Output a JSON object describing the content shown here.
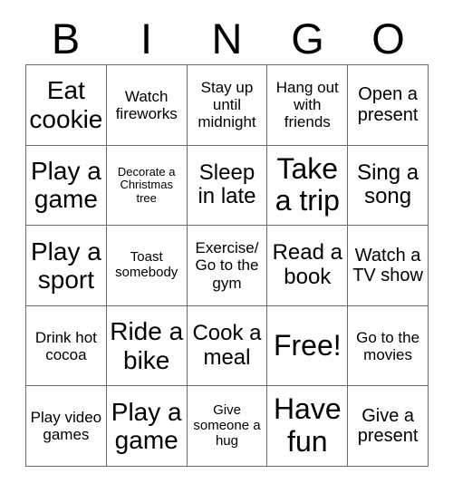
{
  "card": {
    "title": "BINGO",
    "columns": [
      "B",
      "I",
      "N",
      "G",
      "O"
    ],
    "grid_color": "#6b6b6b",
    "background_color": "#ffffff",
    "text_color": "#000000",
    "rows": 5,
    "cols": 5,
    "free_space": "Free!"
  },
  "cells": [
    {
      "text": "Eat cookie",
      "size": "lg"
    },
    {
      "text": "Watch fireworks",
      "size": "xs"
    },
    {
      "text": "Stay up until midnight",
      "size": "xs"
    },
    {
      "text": "Hang out with friends",
      "size": "xs"
    },
    {
      "text": "Open a present",
      "size": "sm"
    },
    {
      "text": "Play a game",
      "size": "lg"
    },
    {
      "text": "Decorate a Christmas tree",
      "size": "tiny"
    },
    {
      "text": "Sleep in late",
      "size": "md"
    },
    {
      "text": "Take a trip",
      "size": "xl"
    },
    {
      "text": "Sing a song",
      "size": "md"
    },
    {
      "text": "Play a sport",
      "size": "lg"
    },
    {
      "text": "Toast somebody",
      "size": "xxs"
    },
    {
      "text": "Exercise/ Go to the gym",
      "size": "xs"
    },
    {
      "text": "Read a book",
      "size": "md"
    },
    {
      "text": "Watch a TV show",
      "size": "sm"
    },
    {
      "text": "Drink hot cocoa",
      "size": "xs"
    },
    {
      "text": "Ride a bike",
      "size": "lg"
    },
    {
      "text": "Cook a meal",
      "size": "md"
    },
    {
      "text": "Free!",
      "size": "xl"
    },
    {
      "text": "Go to the movies",
      "size": "xs"
    },
    {
      "text": "Play video games",
      "size": "xs"
    },
    {
      "text": "Play a game",
      "size": "lg"
    },
    {
      "text": "Give someone a hug",
      "size": "xxs"
    },
    {
      "text": "Have fun",
      "size": "xl"
    },
    {
      "text": "Give a present",
      "size": "sm"
    }
  ]
}
